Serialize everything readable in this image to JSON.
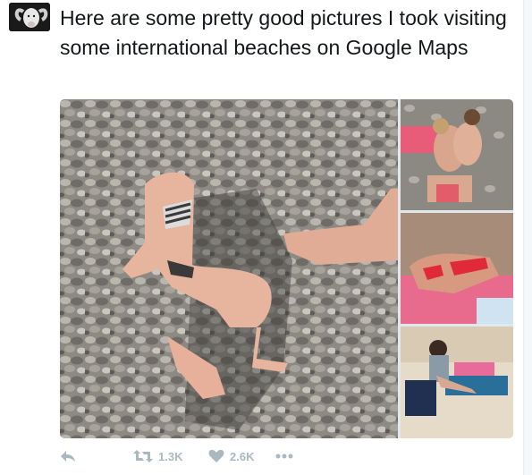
{
  "tweet": {
    "text": "Here are some pretty good pictures I took visiting some international beaches on Google Maps",
    "avatar_icon": "ram-avatar-icon"
  },
  "media": {
    "photos": [
      {
        "name": "beach-photo-main",
        "description_icon": "pebble-beach-photo"
      },
      {
        "name": "beach-photo-2",
        "description_icon": "pebble-beach-photo"
      },
      {
        "name": "beach-photo-3",
        "description_icon": "sunbather-photo"
      },
      {
        "name": "beach-photo-4",
        "description_icon": "sand-beach-photo"
      }
    ]
  },
  "actions": {
    "reply_icon": "reply-icon",
    "retweet_icon": "retweet-icon",
    "retweet_count": "1.3K",
    "like_icon": "heart-icon",
    "like_count": "2.6K",
    "more_icon": "more-icon"
  },
  "colors": {
    "text": "#14171a",
    "action_gray": "#aab8c2",
    "background": "#ffffff"
  }
}
